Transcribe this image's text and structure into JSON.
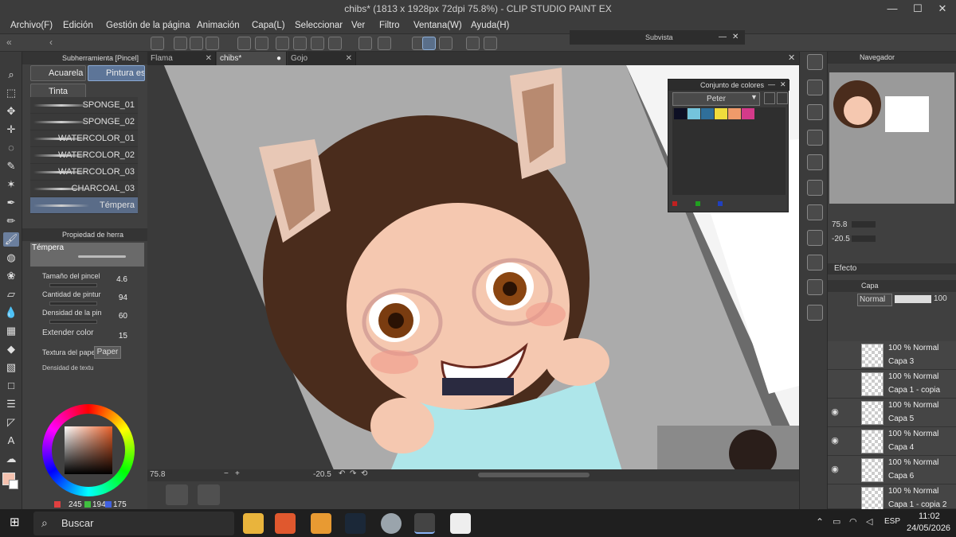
{
  "window": {
    "title": "chibs* (1813 x 1928px 72dpi 75.8%)  - CLIP STUDIO PAINT EX",
    "minimize": "—",
    "maximize": "☐",
    "close": "✕"
  },
  "menu": [
    "Archivo(F)",
    "Edición",
    "Gestión de la página",
    "Animación",
    "Capa(L)",
    "Seleccionar",
    "Ver",
    "Filtro",
    "Ventana(W)",
    "Ayuda(H)"
  ],
  "subvista": {
    "title": "Subvista"
  },
  "subtool": {
    "header": "Subherramienta [Pincel]",
    "buttons": [
      "Acuarela",
      "Pintura esp",
      "Tinta"
    ],
    "brushes": [
      "SPONGE_01",
      "SPONGE_02",
      "WATERCOLOR_01",
      "WATERCOLOR_02",
      "WATERCOLOR_03",
      "CHARCOAL_03",
      "Témpera"
    ]
  },
  "tool_property": {
    "header": "Propiedad de herra",
    "preset": "Témpera",
    "rows": [
      {
        "label": "Tamaño del pincel",
        "value": "4.6"
      },
      {
        "label": "Cantidad de pintur",
        "value": "94"
      },
      {
        "label": "Densidad de la pin",
        "value": "60"
      },
      {
        "label": "Extender color",
        "value": "15"
      }
    ],
    "paper_label": "Textura del papel",
    "paper_value": "Paper",
    "density_label": "Densidad de textu"
  },
  "color": {
    "r": "245",
    "g": "194",
    "b": "175",
    "main": "#f5c2af"
  },
  "tabs": [
    {
      "label": "Flama",
      "active": false
    },
    {
      "label": "chibs*",
      "active": true
    },
    {
      "label": "Gojo",
      "active": false
    }
  ],
  "canvas_status": {
    "zoom": "75.8",
    "angle": "-20.5"
  },
  "color_set": {
    "title": "Conjunto de colores",
    "set_name": "Peter",
    "swatches": [
      "#0d0f24",
      "#74c4dc",
      "#2f6f9a",
      "#f0dc3c",
      "#f09a6a",
      "#d43a8a"
    ]
  },
  "navigator": {
    "header": "Navegador",
    "zoom": "75.8",
    "angle": "-20.5"
  },
  "effect": {
    "label": "Efecto"
  },
  "layers": {
    "header": "Capa",
    "blend_mode": "Normal",
    "opacity": "100",
    "rows": [
      {
        "mode": "100 % Normal",
        "name": "Capa 3",
        "visible": false
      },
      {
        "mode": "100 % Normal",
        "name": "Capa 1 - copia",
        "visible": false
      },
      {
        "mode": "100 % Normal",
        "name": "Capa 5",
        "visible": true
      },
      {
        "mode": "100 % Normal",
        "name": "Capa 4",
        "visible": true
      },
      {
        "mode": "100 % Normal",
        "name": "Capa 6",
        "visible": true
      },
      {
        "mode": "100 % Normal",
        "name": "Capa 1 - copia 2",
        "visible": false
      }
    ]
  },
  "taskbar": {
    "search": "Buscar",
    "lang": "ESP",
    "time": "11:02",
    "date": "24/05/2026"
  }
}
